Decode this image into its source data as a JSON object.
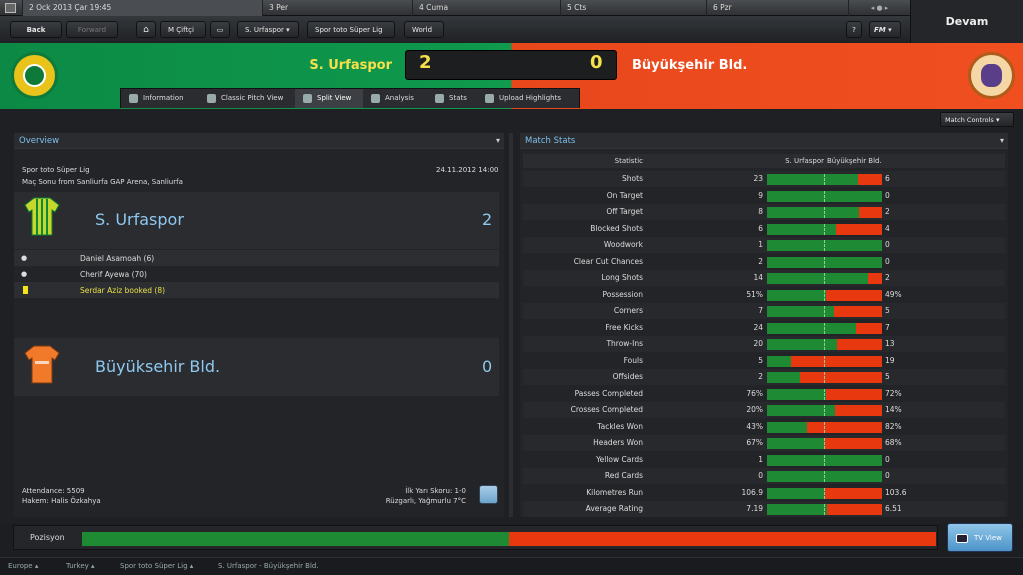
{
  "calendar": {
    "today": "2 Ock 2013 Çar 19:45",
    "days": [
      "3 Per",
      "4 Cuma",
      "5 Cts",
      "6 Pzr"
    ]
  },
  "continue_label": "Devam",
  "nav": {
    "back": "Back",
    "forward": "Forward",
    "manager": "M Çiftçi",
    "club": "S. Urfaspor",
    "competition": "Spor toto Süper Lig",
    "world": "World",
    "fm": "FM",
    "help": "?"
  },
  "score": {
    "home_team": "S. Urfaspor",
    "away_team": "Büyükşehir Bld.",
    "home_goals": "2",
    "away_goals": "0"
  },
  "tabs": [
    "Information",
    "Classic Pitch View",
    "Split View",
    "Analysis",
    "Stats",
    "Upload Highlights"
  ],
  "match_controls": "Match Controls",
  "overview": {
    "title": "Overview",
    "competition": "Spor toto Süper Lig",
    "datetime": "24.11.2012 14:00",
    "venue": "Maç Sonu from Sanliurfa GAP Arena, Sanliurfa",
    "home_name": "S. Urfaspor",
    "home_score": "2",
    "events": [
      "Daniel Asamoah (6)",
      "Cherif Ayewa (70)",
      "Serdar Aziz booked (8)"
    ],
    "away_name": "Büyüksehir Bld.",
    "away_score": "0",
    "attendance": "Attendance: 5509",
    "referee": "Hakem: Halis Özkahya",
    "halftime": "İlk Yarı Skoru: 1-0",
    "weather": "Rüzgarlı, Yağmurlu 7°C"
  },
  "stats": {
    "title": "Match Stats",
    "col_statistic": "Statistic",
    "col_home": "S. Urfaspor",
    "col_away": "Büyükşehir Bld.",
    "rows": [
      {
        "label": "Shots",
        "home": "23",
        "away": "6",
        "home_share": 0.79
      },
      {
        "label": "On Target",
        "home": "9",
        "away": "0",
        "home_share": 1.0
      },
      {
        "label": "Off Target",
        "home": "8",
        "away": "2",
        "home_share": 0.8
      },
      {
        "label": "Blocked Shots",
        "home": "6",
        "away": "4",
        "home_share": 0.6
      },
      {
        "label": "Woodwork",
        "home": "1",
        "away": "0",
        "home_share": 1.0
      },
      {
        "label": "Clear Cut Chances",
        "home": "2",
        "away": "0",
        "home_share": 1.0
      },
      {
        "label": "Long Shots",
        "home": "14",
        "away": "2",
        "home_share": 0.875
      },
      {
        "label": "Possession",
        "home": "51%",
        "away": "49%",
        "home_share": 0.51
      },
      {
        "label": "Corners",
        "home": "7",
        "away": "5",
        "home_share": 0.583
      },
      {
        "label": "Free Kicks",
        "home": "24",
        "away": "7",
        "home_share": 0.774
      },
      {
        "label": "Throw-Ins",
        "home": "20",
        "away": "13",
        "home_share": 0.606
      },
      {
        "label": "Fouls",
        "home": "5",
        "away": "19",
        "home_share": 0.208
      },
      {
        "label": "Offsides",
        "home": "2",
        "away": "5",
        "home_share": 0.286
      },
      {
        "label": "Passes Completed",
        "home": "76%",
        "away": "72%",
        "home_share": 0.514
      },
      {
        "label": "Crosses Completed",
        "home": "20%",
        "away": "14%",
        "home_share": 0.588
      },
      {
        "label": "Tackles Won",
        "home": "43%",
        "away": "82%",
        "home_share": 0.344
      },
      {
        "label": "Headers Won",
        "home": "67%",
        "away": "68%",
        "home_share": 0.496
      },
      {
        "label": "Yellow Cards",
        "home": "1",
        "away": "0",
        "home_share": 1.0
      },
      {
        "label": "Red Cards",
        "home": "0",
        "away": "0",
        "home_share": 1.0
      },
      {
        "label": "Kilometres Run",
        "home": "106.9",
        "away": "103.6",
        "home_share": 0.508
      },
      {
        "label": "Average Rating",
        "home": "7.19",
        "away": "6.51",
        "home_share": 0.525
      }
    ]
  },
  "position": {
    "label": "Pozisyon",
    "home_share": 0.5
  },
  "tv_view": "TV View",
  "breadcrumb": [
    "Europe",
    "Turkey",
    "Spor toto Süper Lig",
    "S. Urfaspor - Büyükşehir Bld."
  ],
  "colors": {
    "home_bar": "#1f8a34",
    "away_bar": "#e8380f",
    "home_header": "#0f9a4d",
    "away_header": "#f05020",
    "accent_text": "#7ec0ef"
  }
}
